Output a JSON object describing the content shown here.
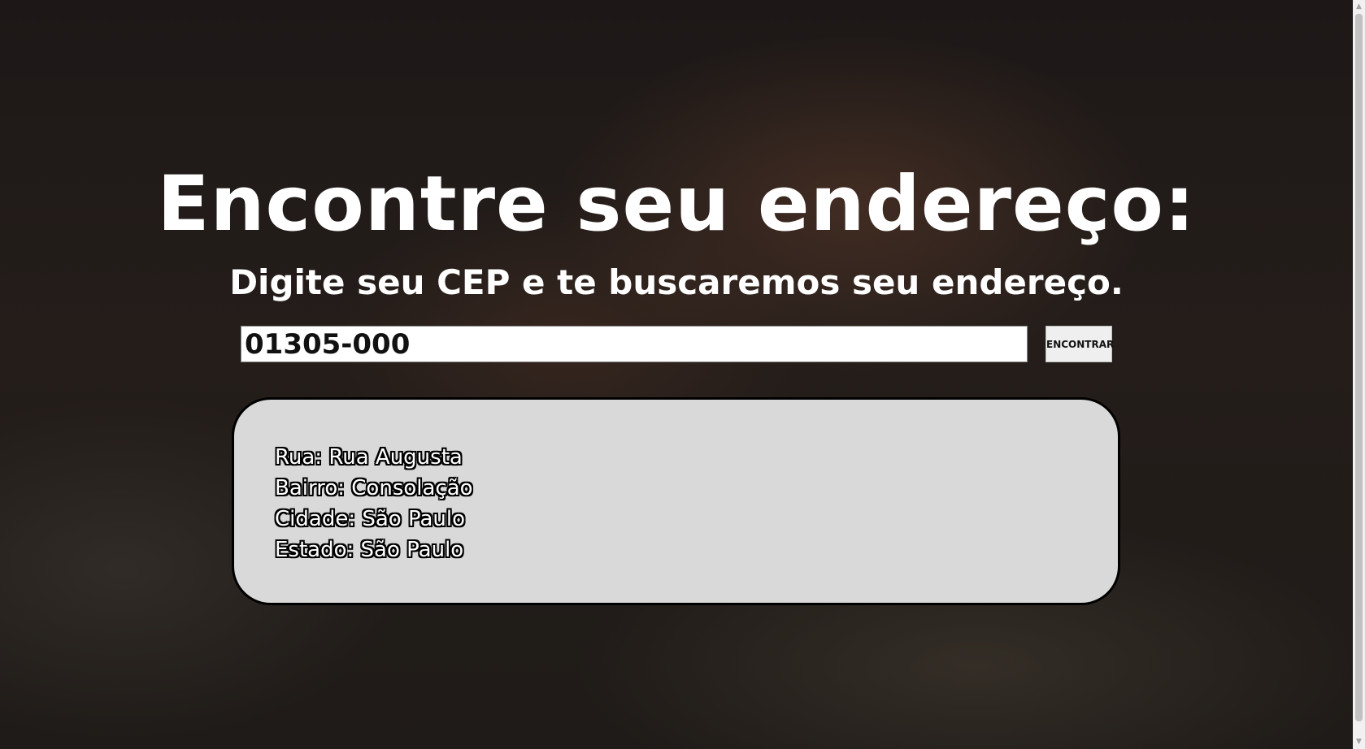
{
  "header": {
    "title": "Encontre seu endereço:",
    "subtitle": "Digite seu CEP e te buscaremos seu endereço."
  },
  "search": {
    "cep_value": "01305-000",
    "button_label": "ENCONTRAR"
  },
  "result": {
    "lines": [
      "Rua: Rua Augusta",
      "Bairro: Consolação",
      "Cidade: São Paulo",
      "Estado: São Paulo"
    ]
  },
  "icons": {
    "scroll_up": "triangle-up",
    "scroll_down": "triangle-down"
  }
}
